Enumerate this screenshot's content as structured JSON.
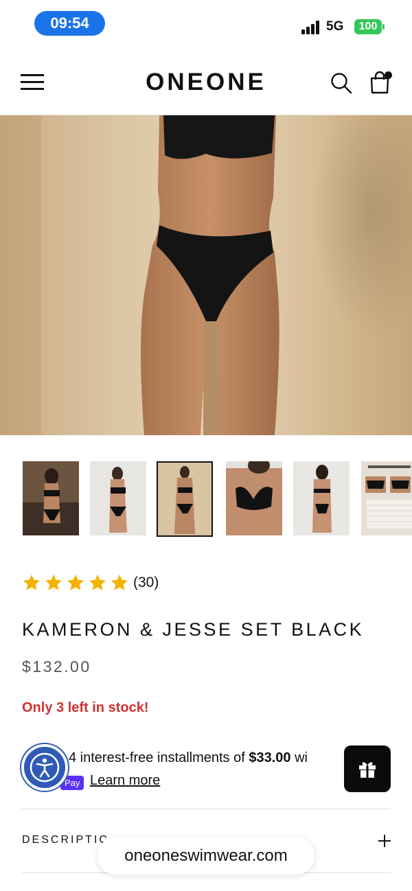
{
  "status_bar": {
    "time": "09:54",
    "network": "5G",
    "battery": "100"
  },
  "header": {
    "brand": "ONEONE"
  },
  "gallery": {
    "thumbnail_count": 6,
    "active_index": 2
  },
  "product": {
    "rating": 5,
    "review_count": "(30)",
    "title": "KAMERON & JESSE SET BLACK",
    "price": "$132.00",
    "stock_message": "Only 3 left in stock!"
  },
  "installments": {
    "prefix": "4 interest-free installments of ",
    "amount": "$33.00",
    "suffix": " wi",
    "shop_pay_label": "Pay",
    "learn_more": "Learn more"
  },
  "accordion": {
    "description_label": "DESCRIPTIC"
  },
  "browser": {
    "url": "oneoneswimwear.com"
  },
  "colors": {
    "accent_blue": "#1a73e8",
    "battery_green": "#34c759",
    "stock_red": "#d03030",
    "star_yellow": "#f5b301",
    "shop_pay_purple": "#5a31f4",
    "accessibility_blue": "#2f5bb7"
  },
  "icons": {
    "menu": "hamburger-icon",
    "search": "search-icon",
    "cart": "shopping-bag-icon",
    "accessibility": "accessibility-icon",
    "gift": "gift-icon",
    "expand": "plus-icon"
  }
}
